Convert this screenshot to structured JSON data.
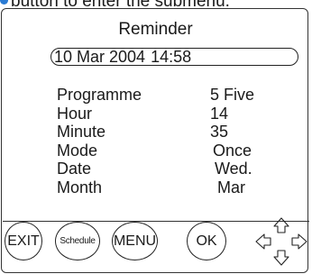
{
  "header": {
    "caption": "button to enter the submenu."
  },
  "screen": {
    "title": "Reminder",
    "date": "10 Mar 2004",
    "time": "14:58",
    "fields": [
      {
        "label": "Programme",
        "value": "5 Five"
      },
      {
        "label": "Hour",
        "value": "14"
      },
      {
        "label": "Minute",
        "value": "35"
      },
      {
        "label": "Mode",
        "value": "Once"
      },
      {
        "label": "Date",
        "value": "Wed."
      },
      {
        "label": "Month",
        "value": "Mar"
      }
    ]
  },
  "buttons": {
    "exit": "EXIT",
    "schedule": "Schedule",
    "menu": "MENU",
    "ok": "OK"
  },
  "icons": {
    "caption_bullet": "blue-dot",
    "nav": "four-way-arrow-pad"
  },
  "colors": {
    "bullet": "#2a7bd4",
    "ink": "#1a1a1a"
  }
}
